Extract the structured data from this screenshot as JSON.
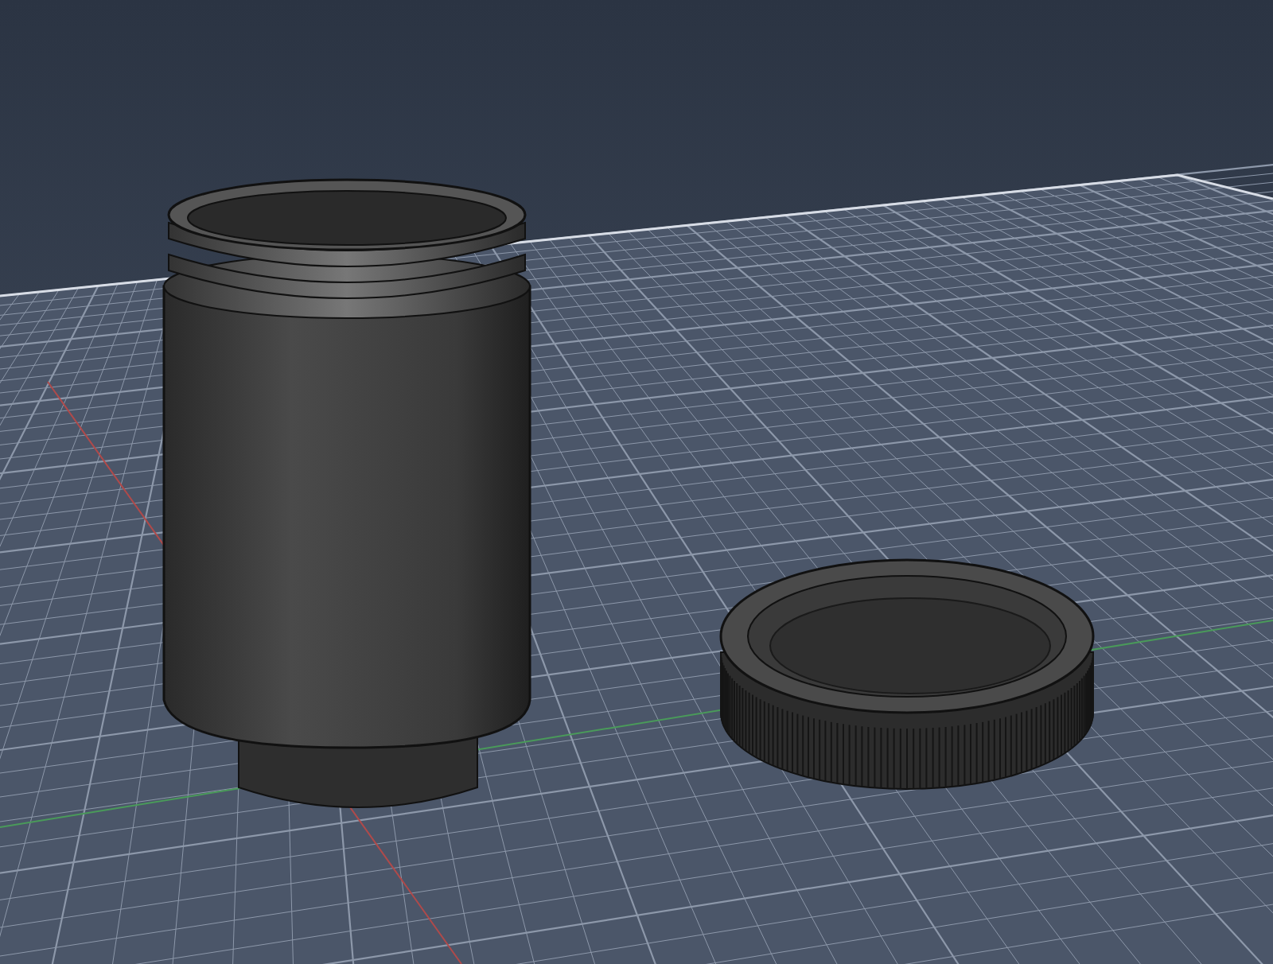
{
  "viewport": {
    "objects": [
      {
        "kind": "jar"
      },
      {
        "kind": "lid"
      }
    ]
  }
}
